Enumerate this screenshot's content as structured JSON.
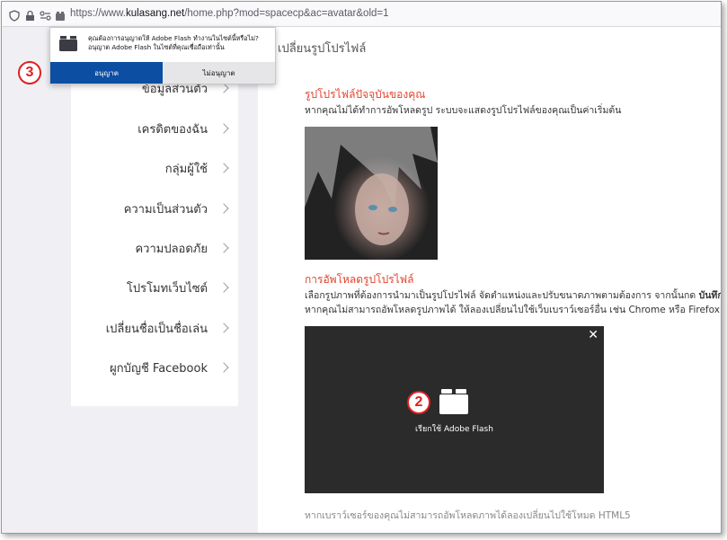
{
  "browser": {
    "url_prefix": "https://www.",
    "url_domain": "kulasang.net",
    "url_rest": "/home.php?mod=spacecp&ac=avatar&old=1"
  },
  "popup": {
    "message": "คุณต้องการอนุญาตให้ Adobe Flash ทำงานในไซต์นี้หรือไม่? อนุญาต Adobe Flash ในไซต์ที่คุณเชื่อถือเท่านั้น",
    "allow_label": "อนุญาต",
    "deny_label": "ไม่อนุญาต",
    "allow_color": "#0b4ea2"
  },
  "annotations": {
    "step_three": "3",
    "step_two": "2"
  },
  "sidebar": {
    "items": [
      {
        "label": "ข้อมูลส่วนตัว"
      },
      {
        "label": "เครดิตของฉัน"
      },
      {
        "label": "กลุ่มผู้ใช้"
      },
      {
        "label": "ความเป็นส่วนตัว"
      },
      {
        "label": "ความปลอดภัย"
      },
      {
        "label": "โปรโมทเว็บไซต์"
      },
      {
        "label": "เปลี่ยนชื่อเป็นชื่อเล่น"
      },
      {
        "label": "ผูกบัญชี Facebook"
      }
    ]
  },
  "main": {
    "title": "เปลี่ยนรูปโปรไฟล์",
    "current_title": "รูปโปรไฟล์ปัจจุบันของคุณ",
    "current_desc": "หากคุณไม่ได้ทำการอัพโหลดรูป ระบบจะแสดงรูปโปรไฟล์ของคุณเป็นค่าเริ่มต้น",
    "upload_title": "การอัพโหลดรูปโปรไฟล์",
    "upload_desc_1": "เลือกรูปภาพที่ต้องการนำมาเป็นรูปโปรไฟล์ จัดตำแหน่งและปรับขนาดภาพตามต้องการ จากนั้นกด",
    "upload_desc_1_bold": "บันทึก",
    "upload_desc_2": "หากคุณไม่สามารถอัพโหลดรูปภาพได้ ให้ลองเปลี่ยนไปใช้เว็บเบราว์เซอร์อื่น เช่น Chrome หรือ Firefox",
    "flash_caption": "เรียกใช้ Adobe Flash",
    "footer": "หากเบราว์เซอร์ของคุณไม่สามารถอัพโหลดภาพได้ลองเปลี่ยนไปใช้โหมด HTML5"
  },
  "colors": {
    "accent_red": "#e2442d",
    "annotation_red": "#e02020"
  }
}
